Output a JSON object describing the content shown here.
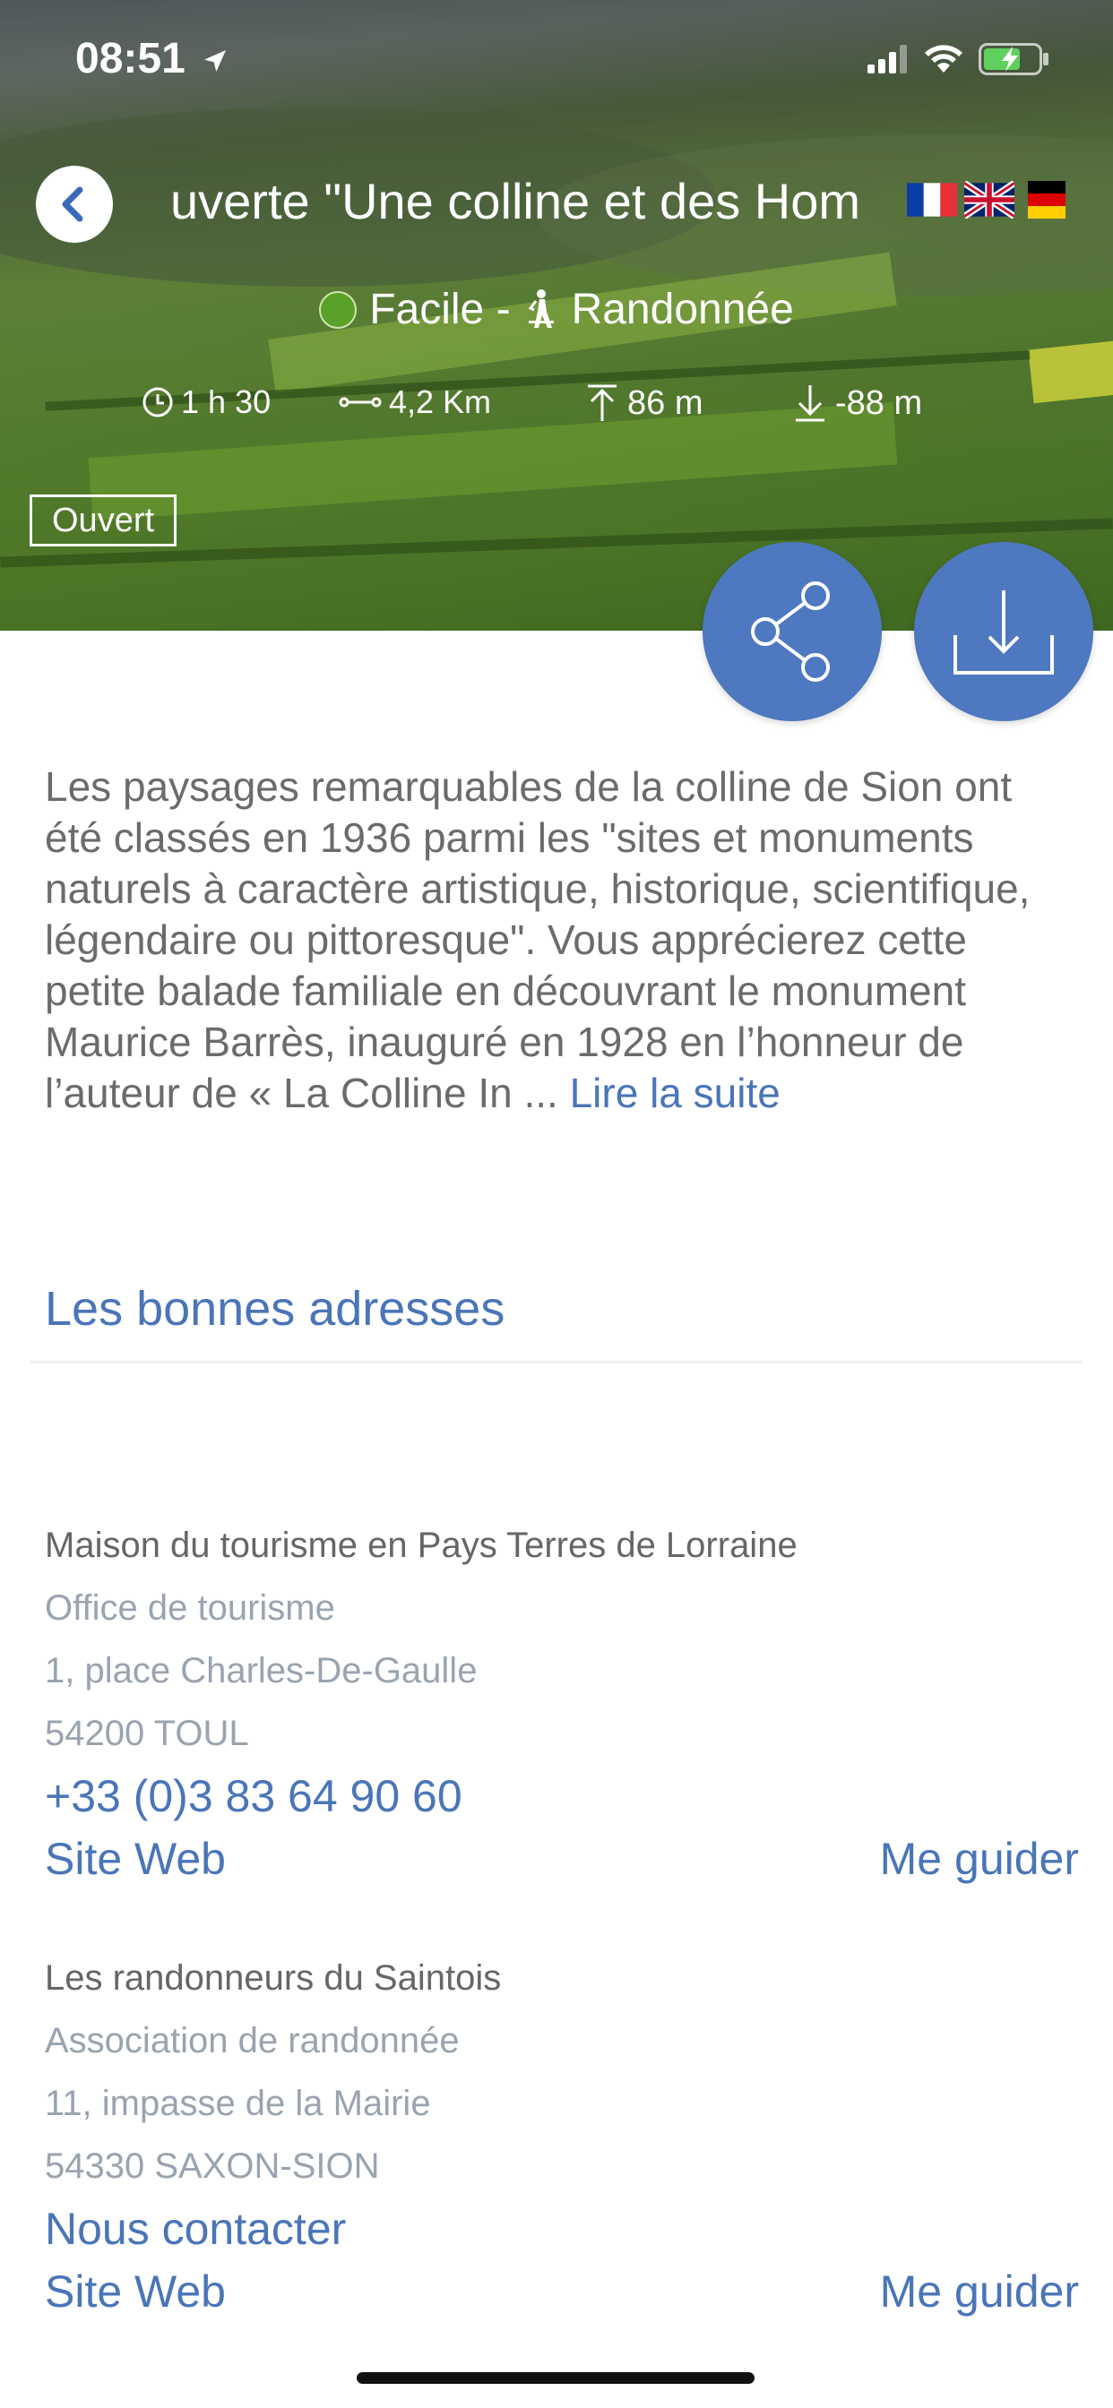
{
  "status_bar": {
    "time": "08:51",
    "icons": [
      "location-arrow-icon",
      "signal-icon",
      "wifi-icon",
      "battery-charging-icon"
    ]
  },
  "header": {
    "title": "uverte \"Une colline et des Hom",
    "languages": [
      "Français",
      "English",
      "Deutsch"
    ]
  },
  "trail": {
    "difficulty": "Facile -",
    "difficulty_color": "#5aa12a",
    "activity": "Randonnée",
    "duration": "1 h 30",
    "distance": "4,2 Km",
    "ascent": "86 m",
    "descent": "-88 m",
    "status": "Ouvert"
  },
  "actions": {
    "share": "share-icon",
    "download": "download-icon",
    "accent_color": "#4e78bf"
  },
  "description": {
    "text": "Les paysages remarquables de la colline de Sion ont été classés en 1936 parmi les \"sites et monuments naturels à caractère artistique, historique, scientifique, légendaire ou pittoresque\". Vous apprécierez cette petite balade familiale en découvrant le monument Maurice Barrès, inauguré en 1928 en l’honneur de l’auteur de « La Colline In ... ",
    "read_more": "Lire la suite"
  },
  "addresses_section": {
    "title": "Les bonnes adresses",
    "items": [
      {
        "name": "Maison du tourisme en Pays Terres de Lorraine",
        "type": "Office de tourisme",
        "street": "1, place Charles-De-Gaulle",
        "city": "54200 TOUL",
        "contact": "+33 (0)3 83 64 90 60",
        "website": "Site Web",
        "guide": "Me guider"
      },
      {
        "name": "Les randonneurs du Saintois",
        "type": "Association de randonnée",
        "street": "11, impasse de la Mairie",
        "city": "54330 SAXON-SION",
        "contact": "Nous contacter",
        "website": "Site Web",
        "guide": "Me guider"
      }
    ]
  }
}
